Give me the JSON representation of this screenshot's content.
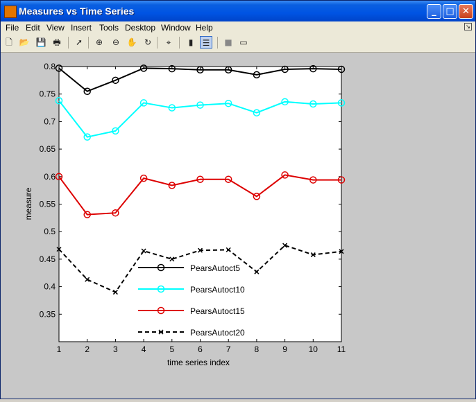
{
  "window": {
    "title": "Measures vs Time Series"
  },
  "menu": {
    "items": [
      "File",
      "Edit",
      "View",
      "Insert",
      "Tools",
      "Desktop",
      "Window",
      "Help"
    ]
  },
  "toolbar": {
    "icons": [
      "new-file-icon",
      "open-file-icon",
      "save-icon",
      "print-icon",
      "pointer-icon",
      "zoom-in-icon",
      "zoom-out-icon",
      "pan-hand-icon",
      "rotate-3d-icon",
      "data-cursor-icon",
      "colorbar-icon",
      "legend-icon",
      "hide-plot-tools-icon",
      "show-plot-tools-icon"
    ]
  },
  "chart_data": {
    "type": "line",
    "title": "",
    "xlabel": "time series index",
    "ylabel": "measure",
    "xlim": [
      1,
      11
    ],
    "ylim": [
      0.3,
      0.8
    ],
    "xticks": [
      "1",
      "2",
      "3",
      "4",
      "5",
      "6",
      "7",
      "8",
      "9",
      "10",
      "11"
    ],
    "yticks": [
      "0.35",
      "0.4",
      "0.45",
      "0.5",
      "0.55",
      "0.6",
      "0.65",
      "0.7",
      "0.75",
      "0.8"
    ],
    "grid": false,
    "legend_position": "inside-lower-middle",
    "x": [
      1,
      2,
      3,
      4,
      5,
      6,
      7,
      8,
      9,
      10,
      11
    ],
    "series": [
      {
        "name": "PearsAutoct5",
        "color": "#000000",
        "marker": "circle",
        "dash": "solid",
        "values": [
          0.797,
          0.755,
          0.775,
          0.797,
          0.796,
          0.794,
          0.794,
          0.785,
          0.795,
          0.796,
          0.795
        ]
      },
      {
        "name": "PearsAutoct10",
        "color": "#00ffff",
        "marker": "circle",
        "dash": "solid",
        "values": [
          0.738,
          0.672,
          0.683,
          0.734,
          0.725,
          0.73,
          0.733,
          0.716,
          0.736,
          0.732,
          0.734
        ]
      },
      {
        "name": "PearsAutoct15",
        "color": "#dd0000",
        "marker": "circle",
        "dash": "solid",
        "values": [
          0.6,
          0.531,
          0.534,
          0.597,
          0.584,
          0.595,
          0.595,
          0.564,
          0.603,
          0.594,
          0.594
        ]
      },
      {
        "name": "PearsAutoct20",
        "color": "#000000",
        "marker": "x",
        "dash": "dashed",
        "values": [
          0.468,
          0.413,
          0.39,
          0.465,
          0.45,
          0.466,
          0.467,
          0.427,
          0.475,
          0.458,
          0.464
        ]
      }
    ]
  }
}
